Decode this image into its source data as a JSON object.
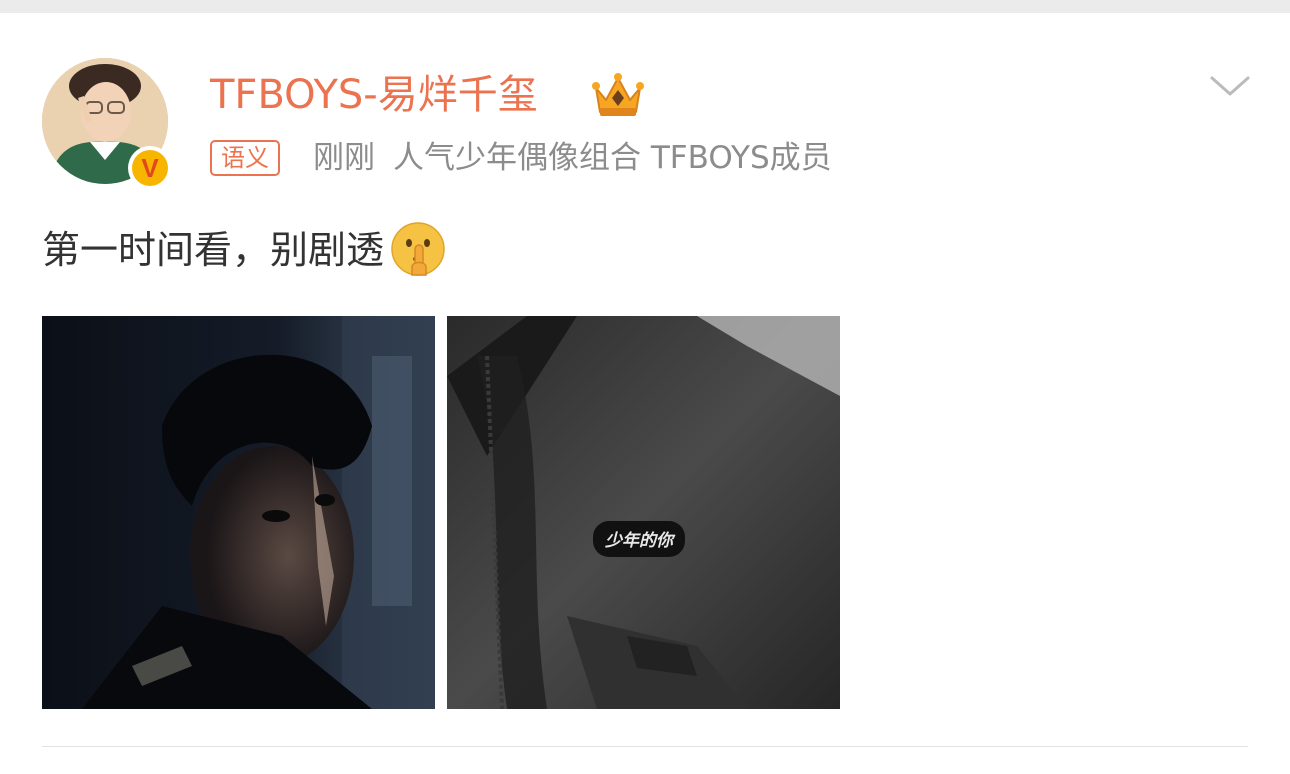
{
  "post": {
    "author": {
      "name": "TFBOYS-易烊千玺",
      "verified_badge_label": "V",
      "crown_icon": "vip-crown-icon"
    },
    "tag": "语义",
    "time": "刚刚",
    "description": "人气少年偶像组合 TFBOYS成员",
    "text": "第一时间看，别剧透",
    "emoji": "shushing-face-icon",
    "photos": [
      {
        "name": "photo-portrait-dark",
        "caption": ""
      },
      {
        "name": "photo-jacket-patch",
        "patch_text": "少年的你"
      }
    ],
    "menu_icon": "chevron-down-icon"
  },
  "colors": {
    "accent": "#eb7350",
    "meta_text": "#8c8c8c",
    "body_text": "#333333",
    "verified_yellow": "#f7b500",
    "top_strip": "#ebebeb"
  }
}
